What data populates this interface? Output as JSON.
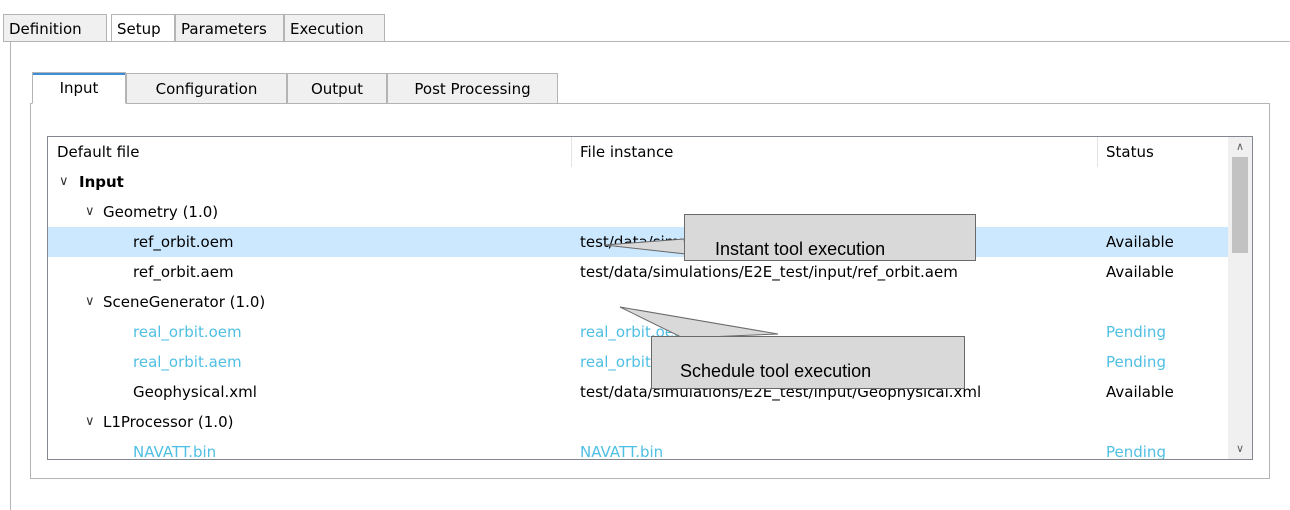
{
  "top_tabs": [
    {
      "label": "Definition",
      "active": false
    },
    {
      "label": "Setup",
      "active": true
    },
    {
      "label": "Parameters",
      "active": false
    },
    {
      "label": "Execution",
      "active": false
    }
  ],
  "inner_tabs": [
    {
      "label": "Input",
      "active": true
    },
    {
      "label": "Configuration",
      "active": false
    },
    {
      "label": "Output",
      "active": false
    },
    {
      "label": "Post Processing",
      "active": false
    }
  ],
  "table": {
    "columns": [
      "Default file",
      "File instance",
      "Status"
    ],
    "rows": [
      {
        "type": "group",
        "label": "Input",
        "instance": "",
        "status": ""
      },
      {
        "type": "subgroup",
        "label": "Geometry (1.0)",
        "instance": "",
        "status": ""
      },
      {
        "type": "file",
        "label": "ref_orbit.oem",
        "instance": "test/data/simulations/E2E_test/input/ref_orbit.oem",
        "status": "Available",
        "pending": false,
        "selected": true
      },
      {
        "type": "file",
        "label": "ref_orbit.aem",
        "instance": "test/data/simulations/E2E_test/input/ref_orbit.aem",
        "status": "Available",
        "pending": false,
        "selected": false
      },
      {
        "type": "subgroup",
        "label": "SceneGenerator (1.0)",
        "instance": "",
        "status": ""
      },
      {
        "type": "file",
        "label": "real_orbit.oem",
        "instance": "real_orbit.oem",
        "status": "Pending",
        "pending": true,
        "selected": false
      },
      {
        "type": "file",
        "label": "real_orbit.aem",
        "instance": "real_orbit.aem",
        "status": "Pending",
        "pending": true,
        "selected": false
      },
      {
        "type": "file",
        "label": "Geophysical.xml",
        "instance": "test/data/simulations/E2E_test/input/Geophysical.xml",
        "status": "Available",
        "pending": false,
        "selected": false
      },
      {
        "type": "subgroup",
        "label": "L1Processor (1.0)",
        "instance": "",
        "status": ""
      },
      {
        "type": "file",
        "label": "NAVATT.bin",
        "instance": "NAVATT.bin",
        "status": "Pending",
        "pending": true,
        "selected": false
      }
    ]
  },
  "icons": {
    "expand": "chevron-down-icon",
    "scroll_up": "arrow-up-icon",
    "scroll_down": "arrow-down-icon"
  },
  "callouts": {
    "instant": "Instant tool execution",
    "schedule": "Schedule tool execution"
  },
  "colors": {
    "pending": "#4fbfe3",
    "selected_row": "#cce8ff",
    "callout_bg": "#d9d9d9"
  }
}
